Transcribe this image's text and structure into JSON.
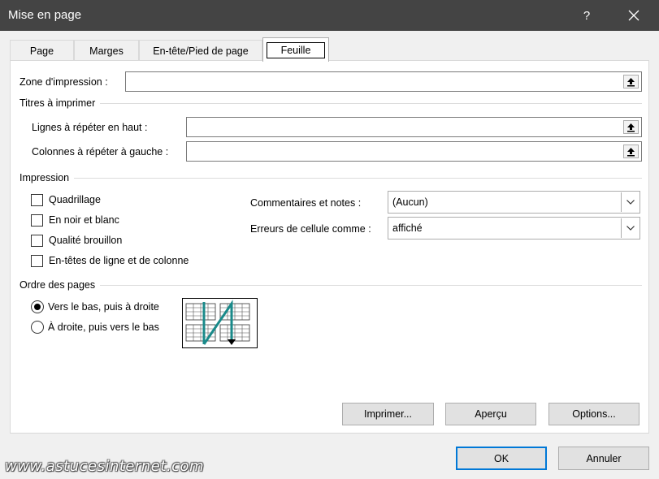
{
  "window": {
    "title": "Mise en page",
    "help_label": "?"
  },
  "tabs": [
    {
      "label": "Page"
    },
    {
      "label": "Marges"
    },
    {
      "label": "En-tête/Pied de page"
    },
    {
      "label": "Feuille"
    }
  ],
  "print_area": {
    "label": "Zone d'impression :",
    "value": ""
  },
  "print_titles": {
    "section_label": "Titres à imprimer",
    "rows_label": "Lignes à répéter en haut :",
    "rows_value": "",
    "cols_label": "Colonnes à répéter à gauche :",
    "cols_value": ""
  },
  "printing": {
    "section_label": "Impression",
    "checkboxes": [
      {
        "label": "Quadrillage",
        "checked": false
      },
      {
        "label": "En noir et blanc",
        "checked": false
      },
      {
        "label": "Qualité brouillon",
        "checked": false
      },
      {
        "label": "En-têtes de ligne et de colonne",
        "checked": false
      }
    ],
    "comments_label": "Commentaires et notes :",
    "comments_value": "(Aucun)",
    "errors_label": "Erreurs de cellule comme :",
    "errors_value": "affiché"
  },
  "page_order": {
    "section_label": "Ordre des pages",
    "options": [
      {
        "label": "Vers le bas, puis à droite",
        "selected": true
      },
      {
        "label": "À droite, puis vers le bas",
        "selected": false
      }
    ]
  },
  "panel_buttons": {
    "print": "Imprimer...",
    "preview": "Aperçu",
    "options": "Options..."
  },
  "dialog_buttons": {
    "ok": "OK",
    "cancel": "Annuler"
  },
  "watermark": "www.astucesinternet.com",
  "colors": {
    "titlebar": "#444444",
    "accent": "#0078d7",
    "order_arrow": "#1a8a8a"
  }
}
